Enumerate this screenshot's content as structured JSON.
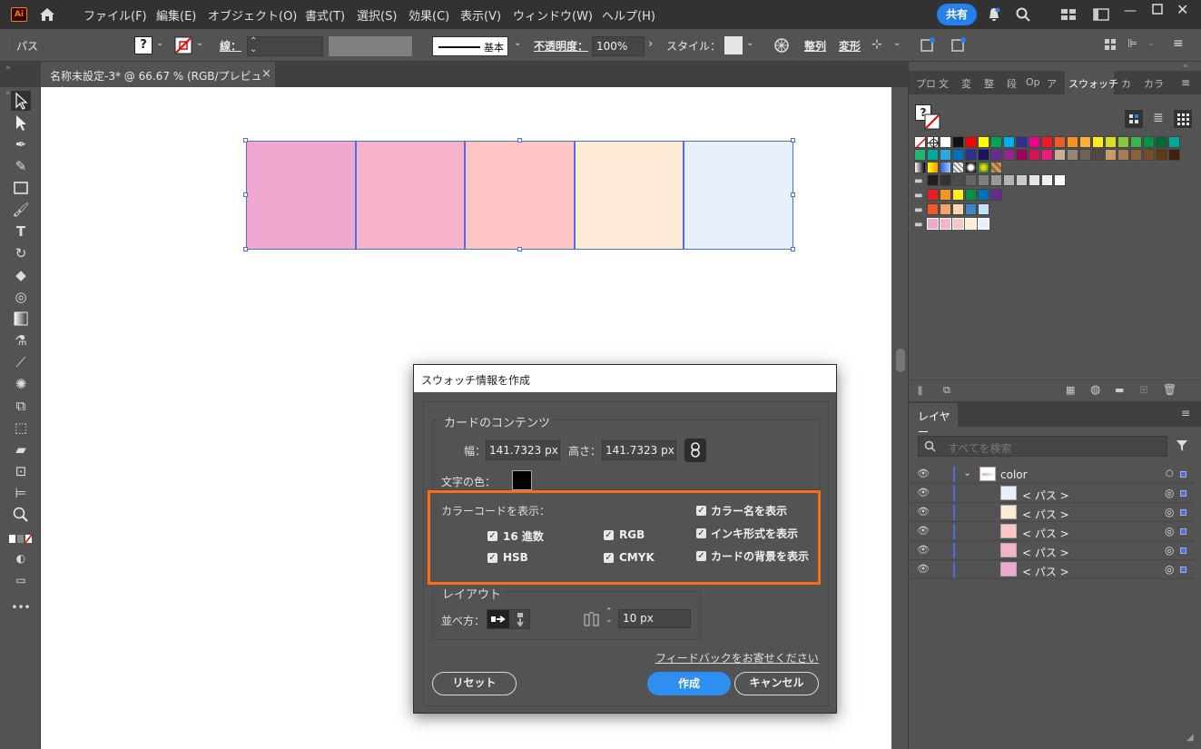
{
  "app": {
    "logo": "Ai",
    "menu": [
      "ファイル(F)",
      "編集(E)",
      "オブジェクト(O)",
      "書式(T)",
      "選択(S)",
      "効果(C)",
      "表示(V)",
      "ウィンドウ(W)",
      "ヘルプ(H)"
    ],
    "share_label": "共有"
  },
  "control_bar": {
    "object_type": "パス",
    "stroke_label": "線：",
    "brush_label": "基本",
    "opacity_label": "不透明度：",
    "opacity_value": "100%",
    "style_label": "スタイル：",
    "align_label": "整列",
    "transform_label": "変形"
  },
  "document": {
    "tab_title": "名称未設定-3* @ 66.67 % (RGB/プレビュー)",
    "close": "×"
  },
  "artwork": {
    "swatch_colors": [
      "#f0a8d0",
      "#f5b2cb",
      "#fec5c5",
      "#feebd5",
      "#e8f0fe"
    ]
  },
  "dialog": {
    "title": "スウォッチ情報を作成",
    "card_contents": "カードのコンテンツ",
    "width_label": "幅：",
    "width_value": "141.7323 px",
    "height_label": "高さ：",
    "height_value": "141.7323 px",
    "text_color_label": "文字の色：",
    "text_color": "#000000",
    "show_codes_label": "カラーコードを表示：",
    "checks": {
      "hex": "16 進数",
      "rgb": "RGB",
      "hsb": "HSB",
      "cmyk": "CMYK",
      "color_name": "カラー名を表示",
      "ink_format": "インキ形式を表示",
      "card_bg": "カードの背景を表示"
    },
    "layout_label": "レイアウト",
    "arrange_label": "並べ方：",
    "spacing_value": "10 px",
    "feedback_link": "フィードバックをお寄せください",
    "reset_button": "リセット",
    "create_button": "作成",
    "cancel_button": "キャンセル",
    "accent_color": "#ff6c16"
  },
  "swatches_panel": {
    "tabs": [
      "プロ",
      "文",
      "変",
      "整",
      "段",
      "Op",
      "ア",
      "スウォッチ",
      "カ",
      "カラ"
    ],
    "active_tab": "スウォッチ"
  },
  "layers_panel": {
    "tab_label": "レイヤー",
    "search_placeholder": "すべてを検索",
    "layer_name": "color",
    "path_items": [
      "< パス >",
      "< パス >",
      "< パス >",
      "< パス >",
      "< パス >"
    ],
    "path_colors": [
      "#e8f0fe",
      "#feebd5",
      "#fec5c5",
      "#f5b2cb",
      "#f0a8d0"
    ]
  }
}
